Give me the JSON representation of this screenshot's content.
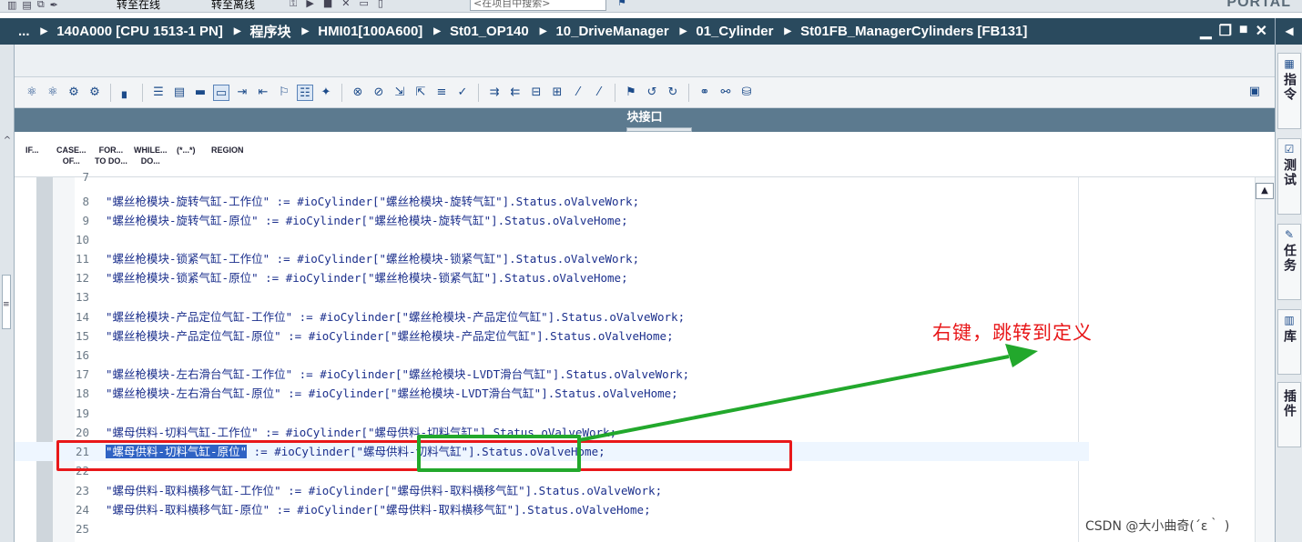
{
  "top_bar": {
    "go_online": "转至在线",
    "go_offline": "转至离线",
    "search_placeholder": "<在项目中搜索>",
    "portal": "PORTAL"
  },
  "breadcrumb": {
    "items": [
      "...",
      "140A000 [CPU 1513-1 PN]",
      "程序块",
      "HMI01[100A600]",
      "St01_OP140",
      "10_DriveManager",
      "01_Cylinder",
      "St01FB_ManagerCylinders [FB131]"
    ]
  },
  "interface_bar": {
    "label": "块接口"
  },
  "snippets": [
    {
      "line1": "IF...",
      "line2": ""
    },
    {
      "line1": "CASE...",
      "line2": "OF..."
    },
    {
      "line1": "FOR...",
      "line2": "TO DO..."
    },
    {
      "line1": "WHILE...",
      "line2": "DO..."
    },
    {
      "line1": "(*...*)",
      "line2": ""
    },
    {
      "line1": "REGION",
      "line2": ""
    }
  ],
  "code_lines": [
    {
      "num": "7",
      "text": ""
    },
    {
      "num": "8",
      "text": "\"螺丝枪模块-旋转气缸-工作位\" := #ioCylinder[\"螺丝枪模块-旋转气缸\"].Status.oValveWork;"
    },
    {
      "num": "9",
      "text": "\"螺丝枪模块-旋转气缸-原位\" := #ioCylinder[\"螺丝枪模块-旋转气缸\"].Status.oValveHome;"
    },
    {
      "num": "10",
      "text": ""
    },
    {
      "num": "11",
      "text": "\"螺丝枪模块-锁紧气缸-工作位\" := #ioCylinder[\"螺丝枪模块-锁紧气缸\"].Status.oValveWork;"
    },
    {
      "num": "12",
      "text": "\"螺丝枪模块-锁紧气缸-原位\" := #ioCylinder[\"螺丝枪模块-锁紧气缸\"].Status.oValveHome;"
    },
    {
      "num": "13",
      "text": ""
    },
    {
      "num": "14",
      "text": "\"螺丝枪模块-产品定位气缸-工作位\" := #ioCylinder[\"螺丝枪模块-产品定位气缸\"].Status.oValveWork;"
    },
    {
      "num": "15",
      "text": "\"螺丝枪模块-产品定位气缸-原位\" := #ioCylinder[\"螺丝枪模块-产品定位气缸\"].Status.oValveHome;"
    },
    {
      "num": "16",
      "text": ""
    },
    {
      "num": "17",
      "text": "\"螺丝枪模块-左右滑台气缸-工作位\" := #ioCylinder[\"螺丝枪模块-LVDT滑台气缸\"].Status.oValveWork;"
    },
    {
      "num": "18",
      "text": "\"螺丝枪模块-左右滑台气缸-原位\" := #ioCylinder[\"螺丝枪模块-LVDT滑台气缸\"].Status.oValveHome;"
    },
    {
      "num": "19",
      "text": ""
    },
    {
      "num": "20",
      "text": "\"螺母供料-切料气缸-工作位\" := #ioCylinder[\"螺母供料-切料气缸\"].Status.oValveWork;"
    },
    {
      "num": "21",
      "text": ""
    },
    {
      "num": "22",
      "text": ""
    },
    {
      "num": "23",
      "text": "\"螺母供料-取料横移气缸-工作位\" := #ioCylinder[\"螺母供料-取料横移气缸\"].Status.oValveWork;"
    },
    {
      "num": "24",
      "text": "\"螺母供料-取料横移气缸-原位\" := #ioCylinder[\"螺母供料-取料横移气缸\"].Status.oValveHome;"
    },
    {
      "num": "25",
      "text": ""
    }
  ],
  "current_line": {
    "selected": "\"螺母供料-切料气缸-原位\"",
    "middle": " := #ioCylinder[",
    "boxed": "\"螺母供料-切料气缸\"",
    "tail": "].Status.oValveHome;"
  },
  "annotation": {
    "text": "右键，跳转到定义",
    "red_color": "#e8181a",
    "green_color": "#22a82c"
  },
  "watermark": "CSDN @大小曲奇(´ε｀ )",
  "right_panel": {
    "tabs": [
      {
        "icon": "instructions-icon",
        "label": "指令"
      },
      {
        "icon": "test-icon",
        "label": "测试"
      },
      {
        "icon": "tasks-icon",
        "label": "任务"
      },
      {
        "icon": "libraries-icon",
        "label": "库"
      },
      {
        "icon": "addins-icon",
        "label": "插件"
      }
    ]
  },
  "colors": {
    "breadcrumb_bg": "#2a4a5e",
    "interface_bar_bg": "#5c7a8f",
    "code_text": "#1b2f8c",
    "selection": "#2f63c4"
  }
}
